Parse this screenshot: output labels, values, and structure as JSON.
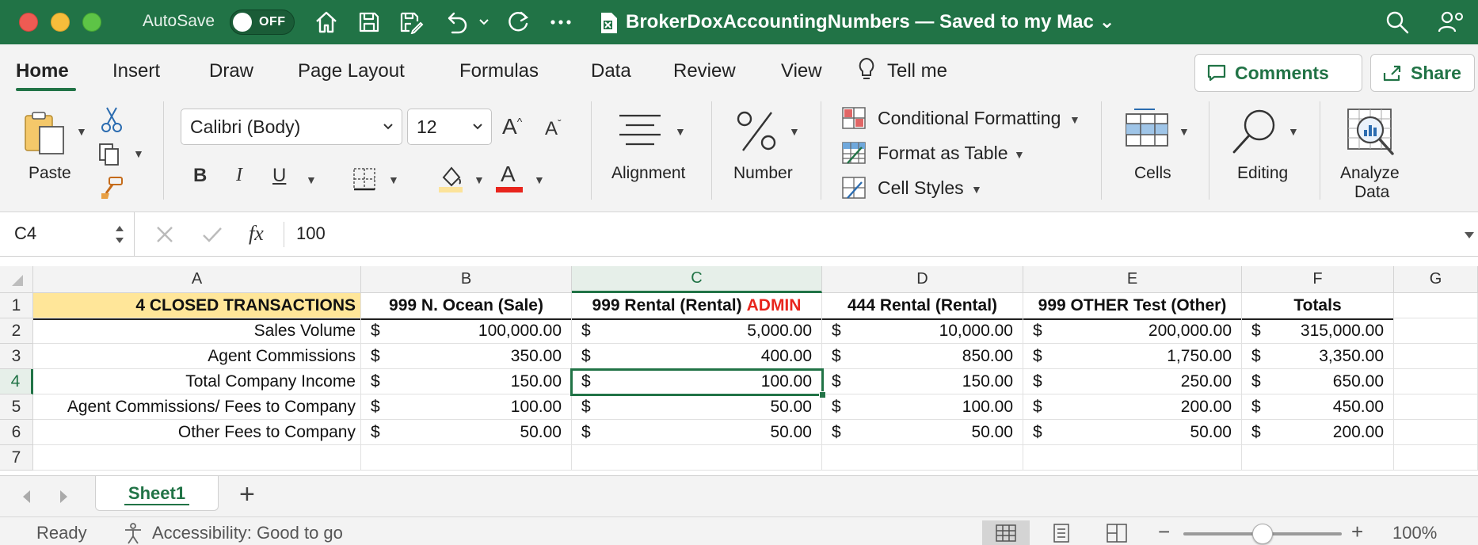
{
  "titlebar": {
    "autosave_label": "AutoSave",
    "autosave_state": "OFF",
    "document_title": "BrokerDoxAccountingNumbers — Saved to my Mac",
    "title_chevron": "⌄"
  },
  "ribbon_tabs": [
    "Home",
    "Insert",
    "Draw",
    "Page Layout",
    "Formulas",
    "Data",
    "Review",
    "View",
    "Tell me"
  ],
  "top_buttons": {
    "comments": "Comments",
    "share": "Share"
  },
  "ribbon": {
    "paste_label": "Paste",
    "font_name": "Calibri (Body)",
    "font_size": "12",
    "alignment_label": "Alignment",
    "number_label": "Number",
    "conditional_formatting": "Conditional Formatting",
    "format_as_table": "Format as Table",
    "cell_styles": "Cell Styles",
    "cells_label": "Cells",
    "editing_label": "Editing",
    "analyze_label_1": "Analyze",
    "analyze_label_2": "Data",
    "bold": "B",
    "italic": "I",
    "underline": "U",
    "font_color_glyph": "A",
    "grow_font": "A",
    "shrink_font": "A"
  },
  "formula_bar": {
    "name_box": "C4",
    "fx": "fx",
    "value": "100"
  },
  "columns": [
    "A",
    "B",
    "C",
    "D",
    "E",
    "F",
    "G"
  ],
  "row_numbers": [
    "1",
    "2",
    "3",
    "4",
    "5",
    "6",
    "7"
  ],
  "sheet": {
    "a1": "4 CLOSED TRANSACTIONS",
    "headers": {
      "b": "999 N. Ocean (Sale)",
      "c": "999 Rental (Rental)",
      "c_admin": "ADMIN",
      "d": "444 Rental (Rental)",
      "e": "999 OTHER Test (Other)",
      "f": "Totals"
    },
    "currency": "$",
    "rows": [
      {
        "label": "Sales Volume",
        "b": "100,000.00",
        "c": "5,000.00",
        "d": "10,000.00",
        "e": "200,000.00",
        "f": "315,000.00"
      },
      {
        "label": "Agent Commissions",
        "b": "350.00",
        "c": "400.00",
        "d": "850.00",
        "e": "1,750.00",
        "f": "3,350.00"
      },
      {
        "label": "Total Company Income",
        "b": "150.00",
        "c": "100.00",
        "d": "150.00",
        "e": "250.00",
        "f": "650.00"
      },
      {
        "label": "Agent Commissions/ Fees to Company",
        "b": "100.00",
        "c": "50.00",
        "d": "100.00",
        "e": "200.00",
        "f": "450.00"
      },
      {
        "label": "Other Fees to Company",
        "b": "50.00",
        "c": "50.00",
        "d": "50.00",
        "e": "50.00",
        "f": "200.00"
      }
    ]
  },
  "sheet_tabs": {
    "active": "Sheet1",
    "add": "+"
  },
  "status": {
    "ready": "Ready",
    "accessibility": "Accessibility: Good to go",
    "zoom_minus": "−",
    "zoom_plus": "+",
    "zoom_level": "100%",
    "zoom_fraction": 0.5
  },
  "colors": {
    "accent": "#217346",
    "header_fill": "#ffe699",
    "admin_red": "#e8251d"
  }
}
